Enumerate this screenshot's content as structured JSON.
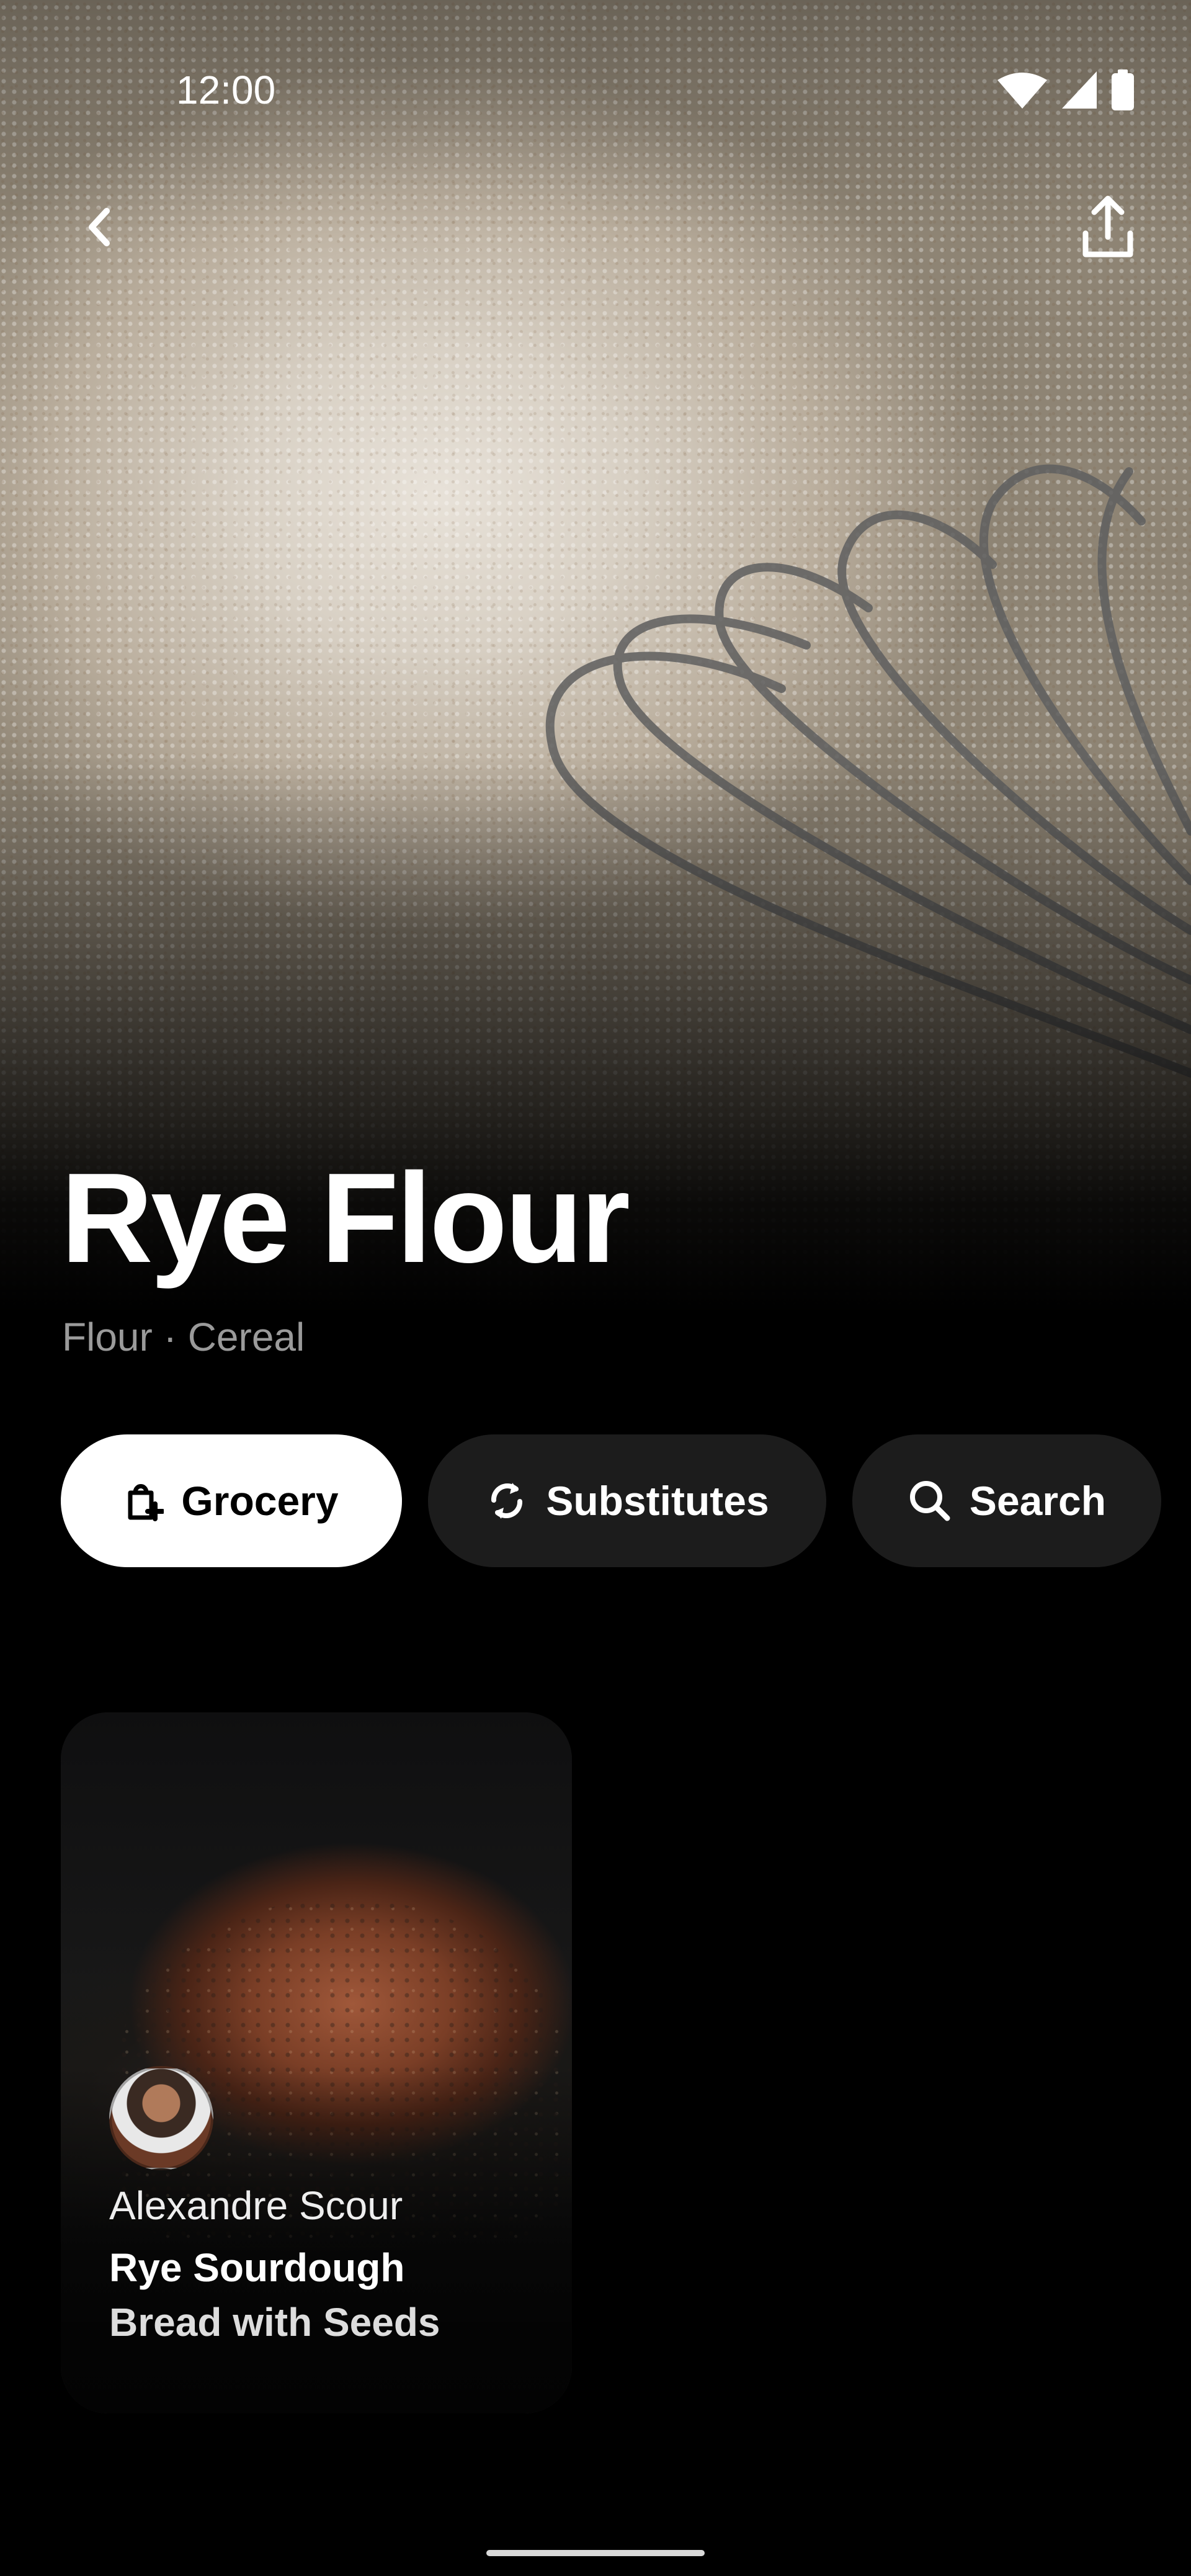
{
  "status_bar": {
    "time": "12:00"
  },
  "header": {
    "back_icon": "chevron-left-icon",
    "share_icon": "share-upload-icon"
  },
  "ingredient": {
    "title": "Rye Flour",
    "subtitle": "Flour · Cereal"
  },
  "actions": [
    {
      "label": "Grocery",
      "icon": "grocery-bag-add-icon",
      "selected": true
    },
    {
      "label": "Substitutes",
      "icon": "swap-refresh-icon",
      "selected": false
    },
    {
      "label": "Search",
      "icon": "search-icon",
      "selected": false
    }
  ],
  "recipe_card": {
    "author": "Alexandre Scour",
    "title_line1": "Rye Sourdough",
    "title_line2": "Bread with Seeds"
  }
}
